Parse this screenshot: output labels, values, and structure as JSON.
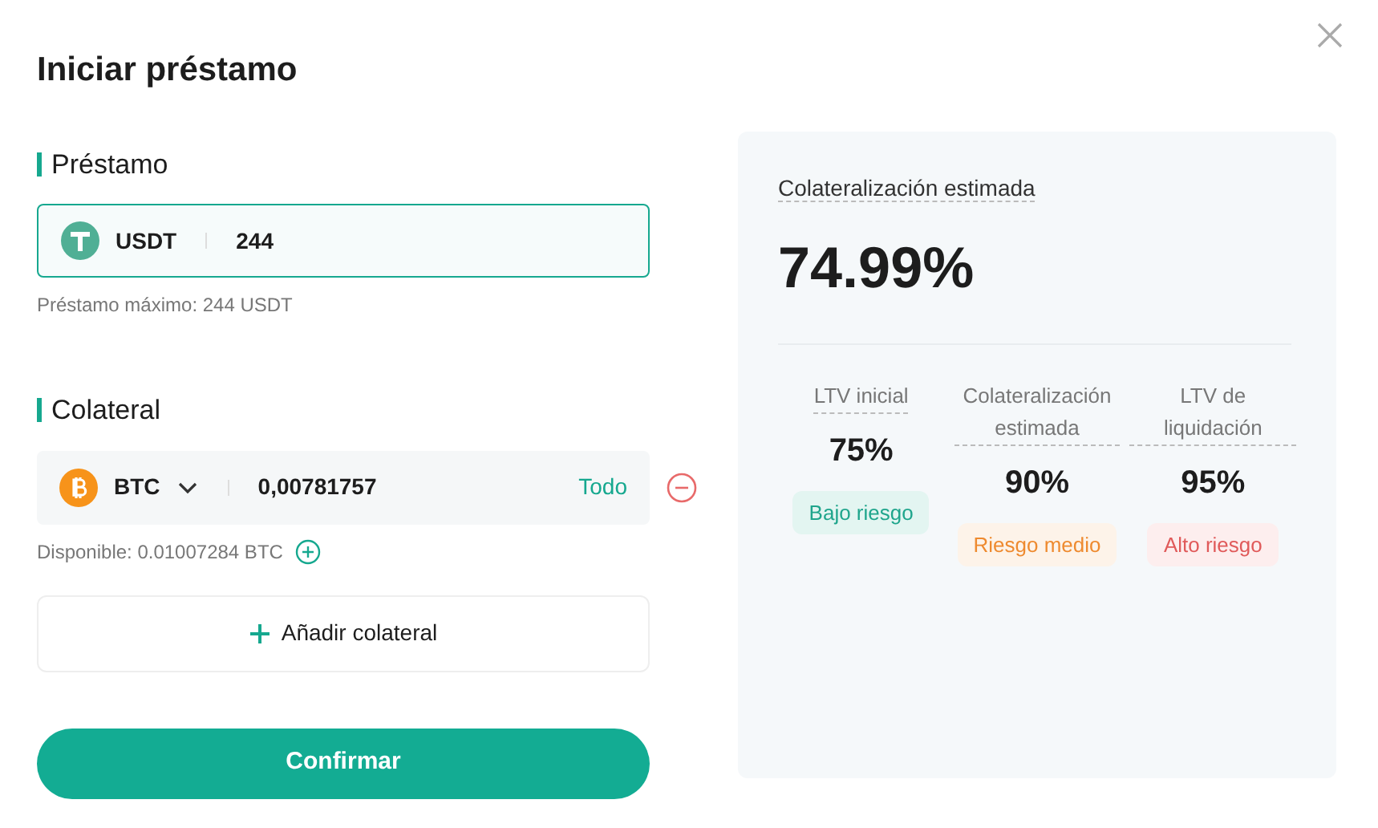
{
  "dialog": {
    "title": "Iniciar préstamo"
  },
  "loan": {
    "heading": "Préstamo",
    "currency": "USDT",
    "amount": "244",
    "hint": "Préstamo máximo: 244 USDT",
    "focused": true
  },
  "collateral": {
    "heading": "Colateral",
    "currency": "BTC",
    "amount": "0,00781757",
    "max_label": "Todo",
    "hint": "Disponible: 0.01007284 BTC",
    "add_label": "Añadir colateral"
  },
  "confirm": {
    "label": "Confirmar"
  },
  "summary": {
    "label": "Colateralización estimada",
    "value": "74.99%",
    "metrics": [
      {
        "label": "LTV inicial",
        "value": "75%",
        "badge": "Bajo riesgo",
        "kind": "low"
      },
      {
        "label": "Colateralización estimada",
        "value": "90%",
        "badge": "Riesgo medio",
        "kind": "medium"
      },
      {
        "label": "LTV de liquidación",
        "value": "95%",
        "badge": "Alto riesgo",
        "kind": "high"
      }
    ]
  }
}
